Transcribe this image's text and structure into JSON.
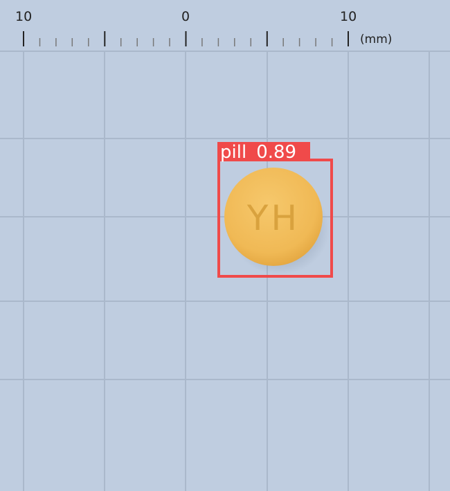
{
  "ruler": {
    "tick_labels": [
      "10",
      "0",
      "10"
    ],
    "unit": "(mm)"
  },
  "detection": {
    "label": "pill",
    "confidence": "0.89",
    "box_color": "#f04a4a"
  },
  "pill": {
    "imprint": "YH",
    "color": "#f3c062"
  },
  "colors": {
    "background": "#bfcde0",
    "grid_line": "#aab8cb"
  }
}
